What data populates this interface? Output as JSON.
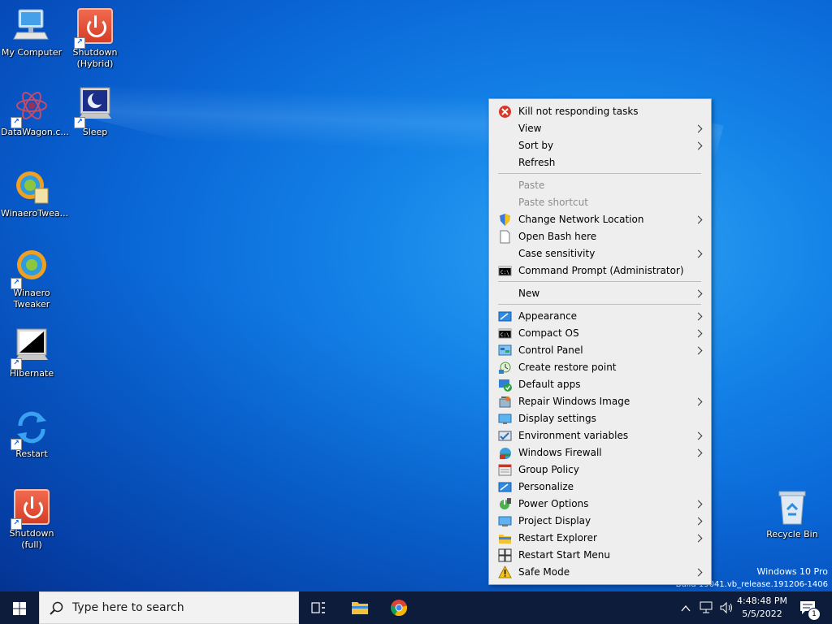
{
  "desktop": {
    "icons": [
      {
        "label": "My Computer",
        "icon": "computer-icon"
      },
      {
        "label": "Shutdown\n(Hybrid)",
        "icon": "power-icon"
      },
      {
        "label": "DataWagon.c...",
        "icon": "datawagon-icon"
      },
      {
        "label": "Sleep",
        "icon": "sleep-icon"
      },
      {
        "label": "WinaeroTwea...",
        "icon": "winaero-installer-icon"
      },
      {
        "label": "Winaero\nTweaker",
        "icon": "winaero-icon"
      },
      {
        "label": "Hibernate",
        "icon": "hibernate-icon"
      },
      {
        "label": "Restart",
        "icon": "restart-icon"
      },
      {
        "label": "Shutdown (full)",
        "icon": "power-icon"
      },
      {
        "label": "Recycle Bin",
        "icon": "recycle-bin-icon"
      }
    ]
  },
  "menu": {
    "items": [
      {
        "label": "Kill not responding tasks",
        "icon": "kill-tasks-icon",
        "submenu": false
      },
      {
        "label": "View",
        "submenu": true
      },
      {
        "label": "Sort by",
        "submenu": true
      },
      {
        "label": "Refresh",
        "submenu": false
      },
      {
        "label": "Paste",
        "disabled": true
      },
      {
        "label": "Paste shortcut",
        "disabled": true
      },
      {
        "label": "Change Network Location",
        "icon": "shield-icon",
        "submenu": true
      },
      {
        "label": "Open Bash here",
        "icon": "document-icon",
        "submenu": false
      },
      {
        "label": "Case sensitivity",
        "submenu": true
      },
      {
        "label": "Command Prompt (Administrator)",
        "icon": "cmd-icon",
        "submenu": false
      },
      {
        "label": "New",
        "submenu": true
      },
      {
        "label": "Appearance",
        "icon": "appearance-icon",
        "submenu": true
      },
      {
        "label": "Compact OS",
        "icon": "cmd-icon",
        "submenu": true
      },
      {
        "label": "Control Panel",
        "icon": "control-panel-icon",
        "submenu": true
      },
      {
        "label": "Create restore point",
        "icon": "restore-point-icon",
        "submenu": false
      },
      {
        "label": "Default apps",
        "icon": "default-apps-icon",
        "submenu": false
      },
      {
        "label": "Repair Windows Image",
        "icon": "repair-icon",
        "submenu": true
      },
      {
        "label": "Display settings",
        "icon": "display-icon",
        "submenu": false
      },
      {
        "label": "Environment variables",
        "icon": "env-vars-icon",
        "submenu": true
      },
      {
        "label": "Windows Firewall",
        "icon": "firewall-icon",
        "submenu": true
      },
      {
        "label": "Group Policy",
        "icon": "group-policy-icon",
        "submenu": false
      },
      {
        "label": "Personalize",
        "icon": "personalize-icon",
        "submenu": false
      },
      {
        "label": "Power Options",
        "icon": "power-options-icon",
        "submenu": true
      },
      {
        "label": "Project Display",
        "icon": "project-display-icon",
        "submenu": true
      },
      {
        "label": "Restart Explorer",
        "icon": "folder-icon",
        "submenu": true
      },
      {
        "label": "Restart Start Menu",
        "icon": "windows-logo-icon",
        "submenu": false
      },
      {
        "label": "Safe Mode",
        "icon": "warning-icon",
        "submenu": true
      }
    ]
  },
  "watermark": {
    "line1": "Windows 10 Pro",
    "line2": "Build 19041.vb_release.191206-1406"
  },
  "taskbar": {
    "search_placeholder": "Type here to search",
    "time": "4:48:48 PM",
    "date": "5/5/2022",
    "notification_count": "1"
  },
  "colors": {
    "accent": "#0a67d6",
    "taskbar": "#0c1c3a",
    "menu_bg": "#eeeeee"
  }
}
